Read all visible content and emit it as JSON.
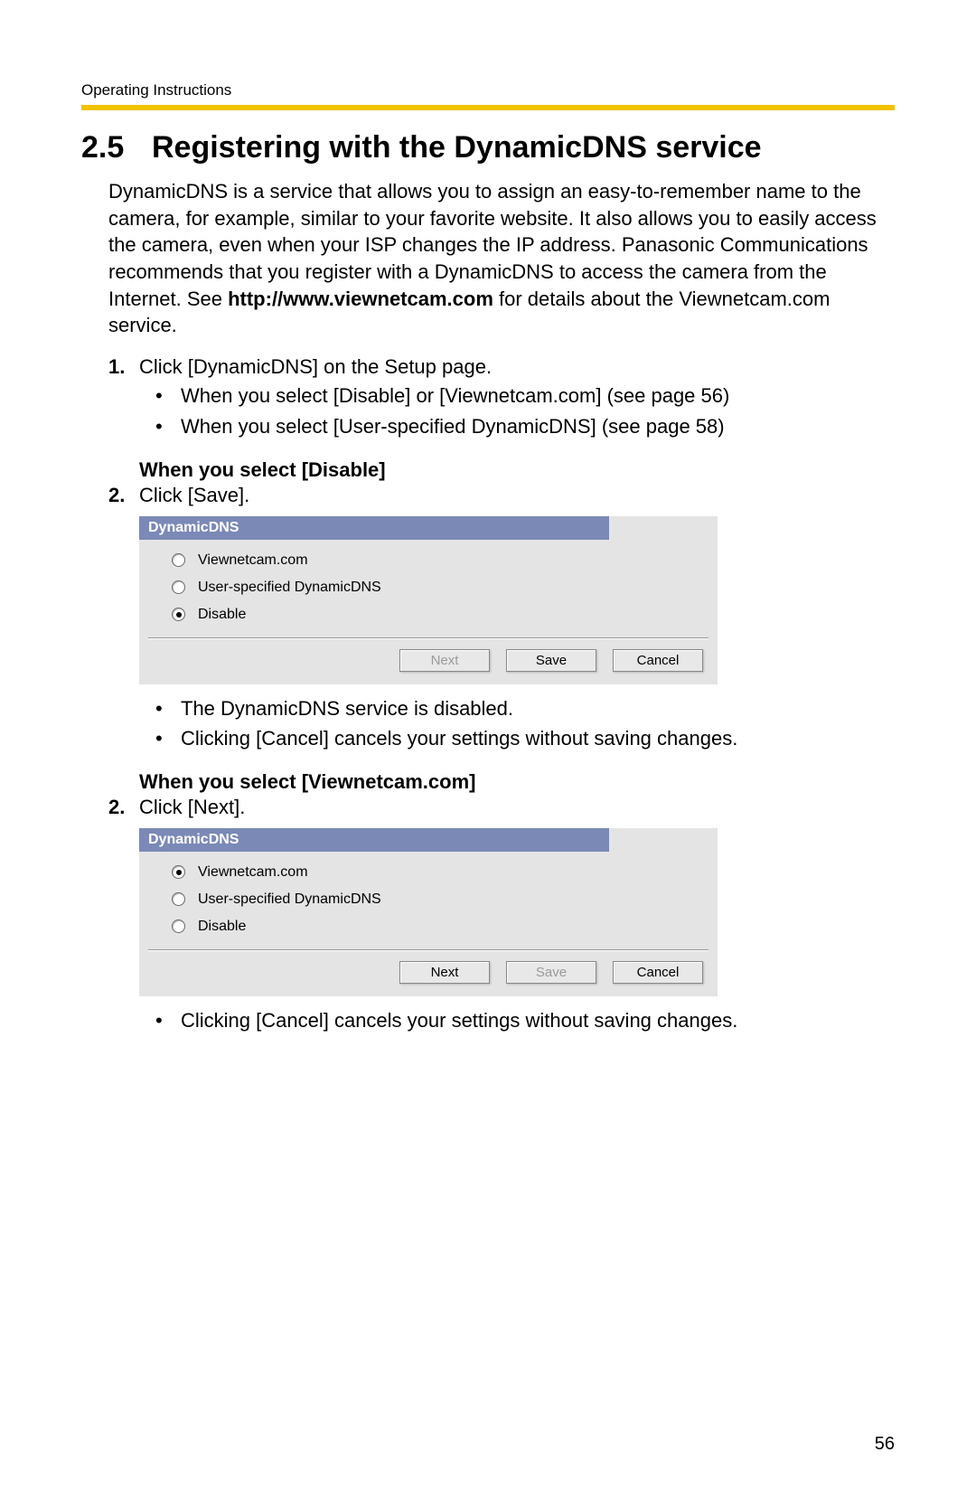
{
  "header": {
    "label": "Operating Instructions"
  },
  "section": {
    "number": "2.5",
    "title": "Registering with the DynamicDNS service"
  },
  "intro": {
    "text1": "DynamicDNS is a service that allows you to assign an easy-to-remember name to the camera, for example, similar to your favorite website. It also allows you to easily access the camera, even when your ISP changes the IP address. Panasonic Communications recommends that you register with a DynamicDNS to access the camera from the Internet. See ",
    "bold": "http://www.viewnetcam.com",
    "text2": " for details about the Viewnetcam.com service."
  },
  "step1": {
    "num": "1.",
    "text": "Click [DynamicDNS] on the Setup page.",
    "sub": [
      "When you select [Disable] or [Viewnetcam.com] (see page 56)",
      "When you select [User-specified DynamicDNS] (see page 58)"
    ]
  },
  "blockA": {
    "heading": "When you select [Disable]",
    "stepnum": "2.",
    "steptext": "Click [Save].",
    "panel": {
      "title": "DynamicDNS",
      "options": [
        {
          "label": "Viewnetcam.com",
          "checked": false
        },
        {
          "label": "User-specified DynamicDNS",
          "checked": false
        },
        {
          "label": "Disable",
          "checked": true
        }
      ],
      "buttons": {
        "next": "Next",
        "save": "Save",
        "cancel": "Cancel",
        "next_disabled": true,
        "save_disabled": false
      }
    },
    "notes": [
      "The DynamicDNS service is disabled.",
      "Clicking [Cancel] cancels your settings without saving changes."
    ]
  },
  "blockB": {
    "heading": "When you select [Viewnetcam.com]",
    "stepnum": "2.",
    "steptext": "Click [Next].",
    "panel": {
      "title": "DynamicDNS",
      "options": [
        {
          "label": "Viewnetcam.com",
          "checked": true
        },
        {
          "label": "User-specified DynamicDNS",
          "checked": false
        },
        {
          "label": "Disable",
          "checked": false
        }
      ],
      "buttons": {
        "next": "Next",
        "save": "Save",
        "cancel": "Cancel",
        "next_disabled": false,
        "save_disabled": true
      }
    },
    "notes": [
      "Clicking [Cancel] cancels your settings without saving changes."
    ]
  },
  "page_number": "56"
}
